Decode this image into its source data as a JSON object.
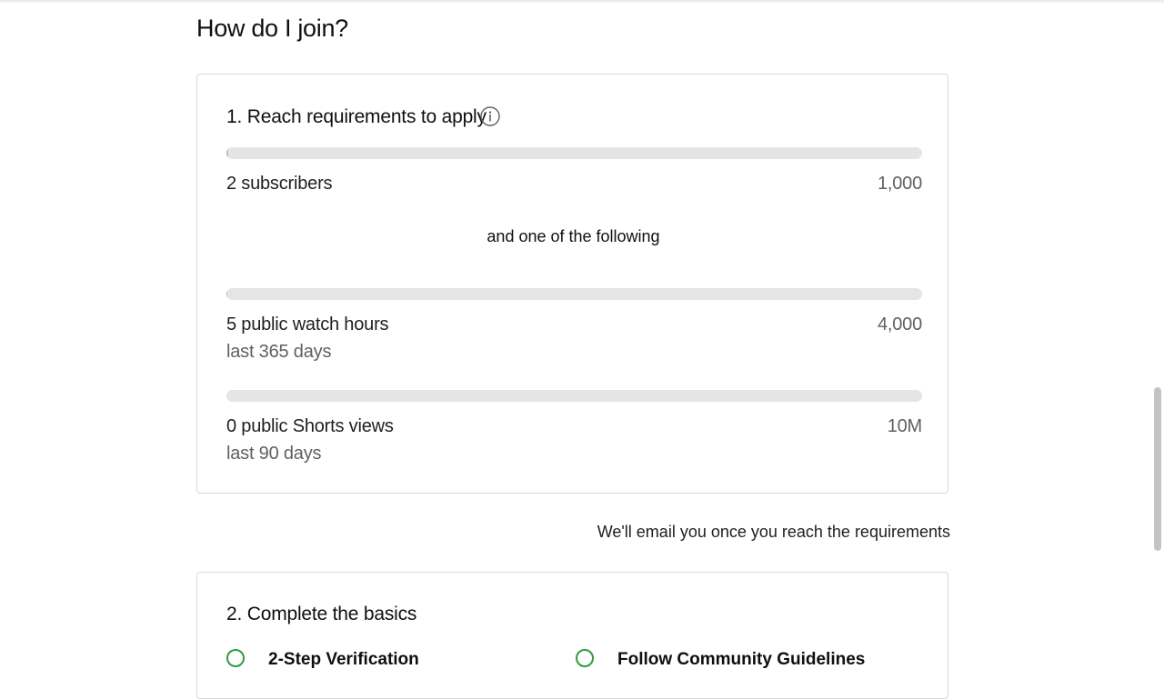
{
  "section": {
    "title": "How do I join?"
  },
  "requirements_card": {
    "title": "1. Reach requirements to apply",
    "subscribers": {
      "label": "2 subscribers",
      "target": "1,000",
      "progress": 0.002
    },
    "or_text": "and one of the following",
    "watch_hours": {
      "label": "5 public watch hours",
      "period": "last 365 days",
      "target": "4,000",
      "progress": 0.00125
    },
    "shorts_views": {
      "label": "0 public Shorts views",
      "period": "last 90 days",
      "target": "10M",
      "progress": 0
    }
  },
  "email_note": "We'll email you once you reach the requirements",
  "basics_card": {
    "title": "2. Complete the basics",
    "items": [
      {
        "label": "2-Step Verification"
      },
      {
        "label": "Follow Community Guidelines"
      }
    ]
  },
  "colors": {
    "check_green": "#2e9c3e",
    "bar_track": "#e5e5e5"
  },
  "icons": {
    "info": "info-circle-icon",
    "check": "check-circle-icon"
  }
}
